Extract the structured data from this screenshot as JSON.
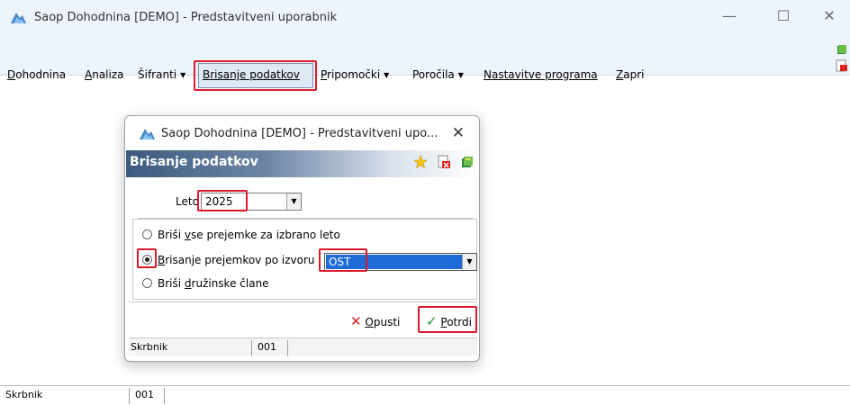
{
  "window": {
    "title": "Saop Dohodnina [DEMO] - Predstavitveni uporabnik",
    "minimize": "—",
    "maximize": "☐",
    "close": "✕"
  },
  "menu": {
    "items": [
      {
        "label": "Dohodnina",
        "u": "D",
        "rest": "ohodnina"
      },
      {
        "label": "Analiza",
        "u": "A",
        "rest": "naliza"
      },
      {
        "label": "Šifranti",
        "u": "",
        "rest": "Šifranti"
      },
      {
        "label": "Brisanje podatkov",
        "u": "B",
        "rest": "risanje podatkov"
      },
      {
        "label": "Pripomočki",
        "u": "P",
        "rest": "ripomočki"
      },
      {
        "label": "Poročila",
        "u": "",
        "rest": "Poročila"
      },
      {
        "label": "Nastavitve programa",
        "u": "N",
        "rest": "astavitve programa"
      },
      {
        "label": "Zapri",
        "u": "Z",
        "rest": "apri"
      }
    ],
    "arrow": "▼"
  },
  "dialog": {
    "title": "Saop Dohodnina [DEMO] - Predstavitveni upo...",
    "close": "✕",
    "header": "Brisanje podatkov",
    "year_label": "Leto",
    "year_value": "2025",
    "options": [
      {
        "pre": "Briši ",
        "u": "v",
        "post": "se prejemke za izbrano leto",
        "selected": false
      },
      {
        "pre": "",
        "u": "B",
        "post": "risanje prejemkov po izvoru",
        "selected": true
      },
      {
        "pre": "Briši ",
        "u": "d",
        "post": "ružinske člane",
        "selected": false
      }
    ],
    "source_value": "OST",
    "cancel_u": "O",
    "cancel_rest": "pusti",
    "confirm_u": "P",
    "confirm_rest": "otrdi",
    "status_user": "Skrbnik",
    "status_code": "001"
  },
  "status": {
    "user": "Skrbnik",
    "code": "001"
  },
  "colors": {
    "highlight": "#d81c2c",
    "header_bg": "#3c5a7e",
    "selection": "#1e6ad6"
  }
}
